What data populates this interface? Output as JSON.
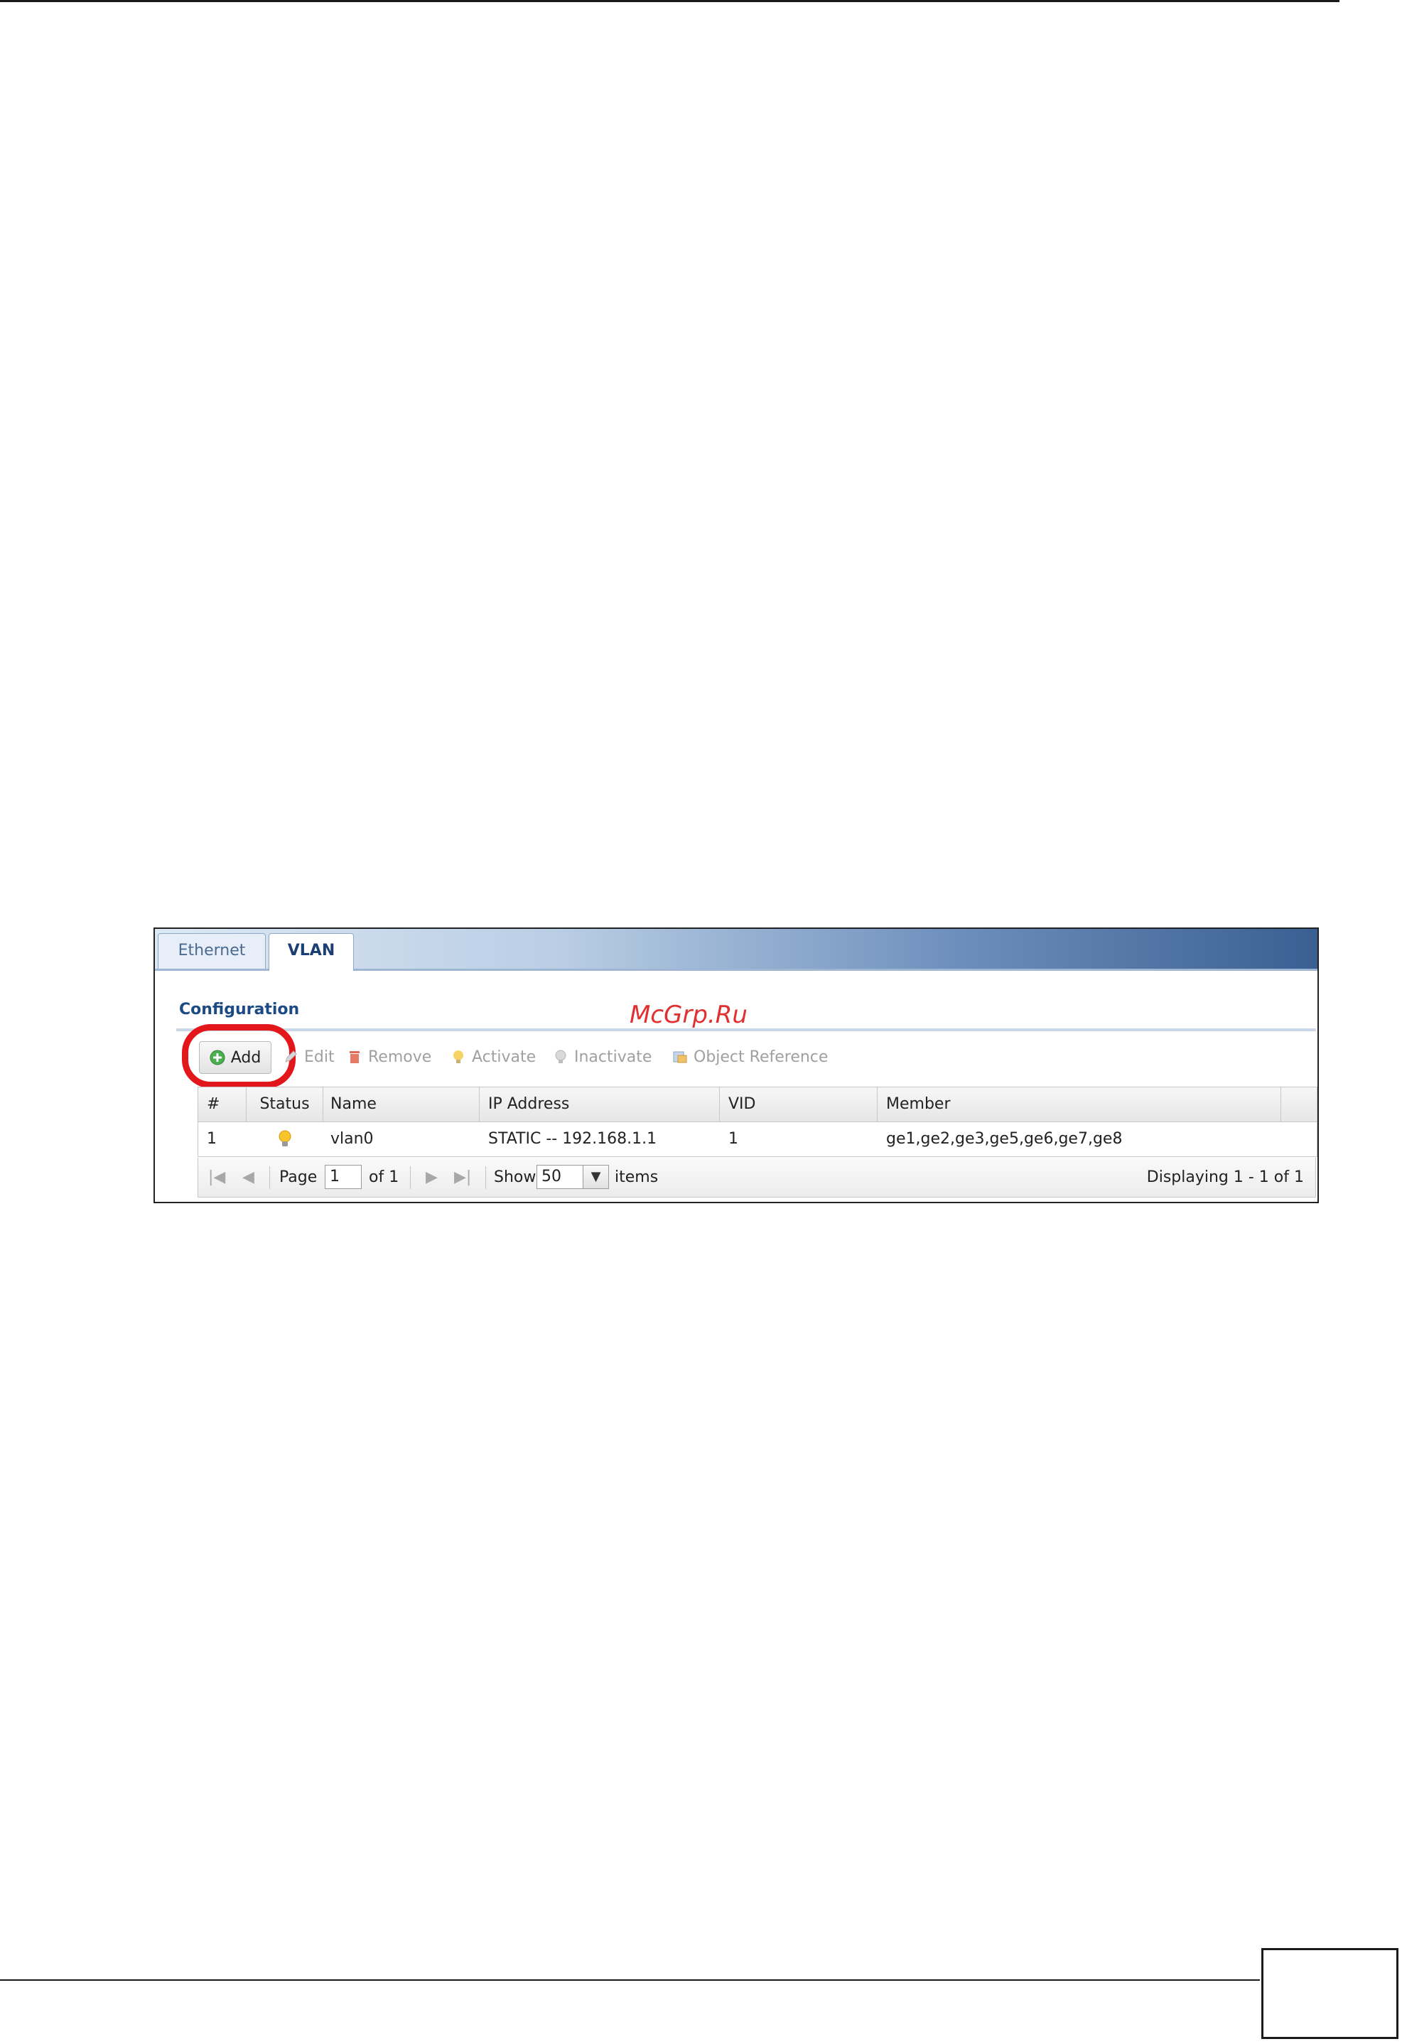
{
  "tabs": [
    {
      "label": "Ethernet",
      "active": false
    },
    {
      "label": "VLAN",
      "active": true
    }
  ],
  "section_title": "Configuration",
  "watermark": "McGrp.Ru",
  "toolbar": {
    "add": "Add",
    "edit": "Edit",
    "remove": "Remove",
    "activate": "Activate",
    "inactivate": "Inactivate",
    "object_reference": "Object Reference"
  },
  "table": {
    "columns": [
      "#",
      "Status",
      "Name",
      "IP Address",
      "VID",
      "Member"
    ],
    "rows": [
      {
        "index": "1",
        "status": "lightbulb-on-icon",
        "name": "vlan0",
        "ip": "STATIC -- 192.168.1.1",
        "vid": "1",
        "member": "ge1,ge2,ge3,ge5,ge6,ge7,ge8"
      }
    ]
  },
  "pager": {
    "page_label": "Page",
    "page_value": "1",
    "of_label": "of 1",
    "show_label": "Show",
    "show_value": "50",
    "items_label": "items",
    "displaying": "Displaying 1 - 1 of 1"
  },
  "colors": {
    "highlight_ring": "#e3161b",
    "section_title": "#1b4a84",
    "watermark": "#e03030"
  }
}
